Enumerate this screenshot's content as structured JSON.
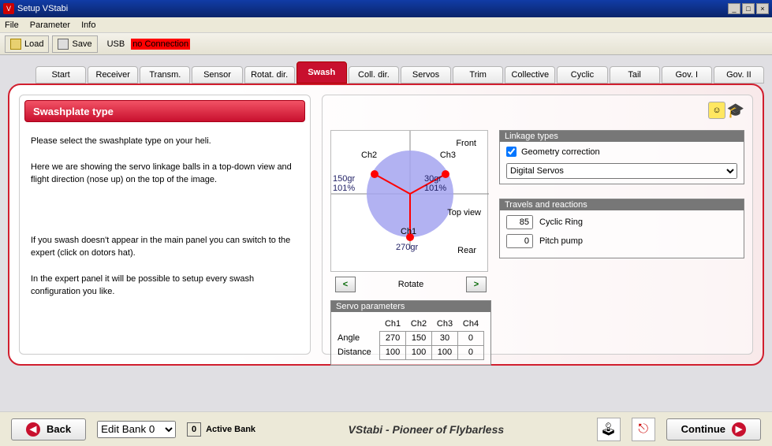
{
  "window": {
    "title": "Setup VStabi"
  },
  "menubar": [
    "File",
    "Parameter",
    "Info"
  ],
  "toolbar": {
    "load": "Load",
    "save": "Save",
    "usb_label": "USB",
    "connection": "no Connection"
  },
  "tabs": [
    "Start",
    "Receiver",
    "Transm.",
    "Sensor",
    "Rotat. dir.",
    "Swash",
    "Coll. dir.",
    "Servos",
    "Trim",
    "Collective",
    "Cyclic",
    "Tail",
    "Gov. I",
    "Gov. II"
  ],
  "active_tab": 5,
  "left": {
    "title": "Swashplate type",
    "p1": "Please select the swashplate type on your heli.",
    "p2": "Here we are showing the servo linkage balls in a top-down view and flight direction (nose up) on the top of the image.",
    "p3": "If you swash doesn't appear in the main panel you can switch to the expert (click on dotors hat).",
    "p4": "In the expert panel it will be possible to setup every swash configuration you like."
  },
  "diagram": {
    "front": "Front",
    "rear": "Rear",
    "topview": "Top view",
    "ch1": "Ch1",
    "ch2": "Ch2",
    "ch3": "Ch3",
    "ch1_deg": "270gr",
    "ch2_deg": "150gr",
    "ch2_pct": "101%",
    "ch3_deg": "30gr",
    "ch3_pct": "101%",
    "rotate_label": "Rotate"
  },
  "linkage": {
    "title": "Linkage types",
    "geometry": "Geometry correction",
    "geometry_checked": true,
    "servo_select": "Digital Servos"
  },
  "travels": {
    "title": "Travels and reactions",
    "cyclic_ring_label": "Cyclic Ring",
    "cyclic_ring_val": "85",
    "pitch_pump_label": "Pitch pump",
    "pitch_pump_val": "0"
  },
  "servo_params": {
    "title": "Servo parameters",
    "headers": [
      "Ch1",
      "Ch2",
      "Ch3",
      "Ch4"
    ],
    "rows": [
      {
        "label": "Angle",
        "values": [
          "270",
          "150",
          "30",
          "0"
        ]
      },
      {
        "label": "Distance",
        "values": [
          "100",
          "100",
          "100",
          "0"
        ]
      }
    ]
  },
  "footer": {
    "back": "Back",
    "continue": "Continue",
    "bank_select": "Edit Bank 0",
    "active_bank_val": "0",
    "active_bank_label": "Active Bank",
    "slogan": "VStabi - Pioneer of Flybarless"
  }
}
